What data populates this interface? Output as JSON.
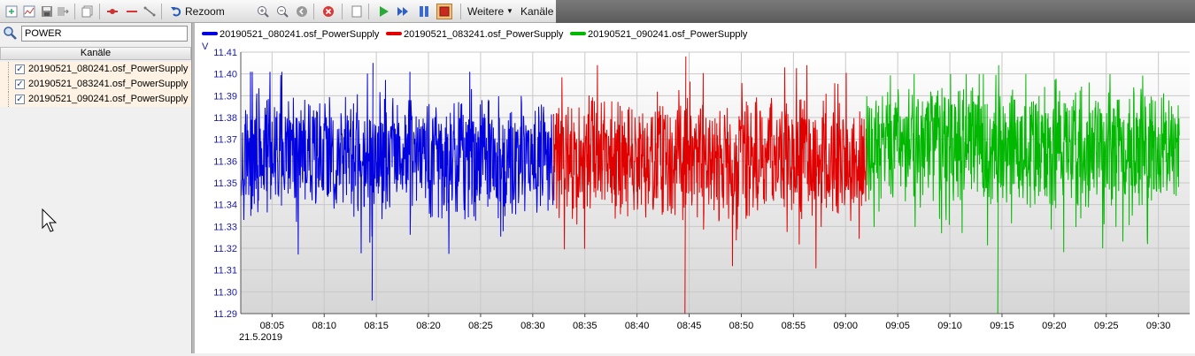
{
  "toolbar": {
    "rezoom_label": "Rezoom",
    "weitere_label": "Weitere",
    "kanale_label": "Kanäle",
    "icons": [
      "add-icon",
      "chart-icon",
      "save-icon",
      "export-icon",
      "copy-icon",
      "marker-icon",
      "line-icon",
      "connect-icon",
      "undo-icon",
      "zoom-in-icon",
      "zoom-out-icon",
      "back-icon",
      "stop-icon",
      "window-icon",
      "play-icon",
      "fast-forward-icon",
      "pause-icon",
      "record-icon"
    ]
  },
  "sidebar": {
    "search_value": "POWER",
    "header": "Kanäle",
    "channels": [
      {
        "label": "20190521_080241.osf_PowerSupply",
        "checked": true
      },
      {
        "label": "20190521_083241.osf_PowerSupply",
        "checked": true
      },
      {
        "label": "20190521_090241.osf_PowerSupply",
        "checked": true
      }
    ]
  },
  "chart_data": {
    "type": "line",
    "ylabel": "V",
    "ylim": [
      11.29,
      11.41
    ],
    "y_ticks": [
      "11.41",
      "11.40",
      "11.39",
      "11.38",
      "11.37",
      "11.36",
      "11.35",
      "11.34",
      "11.33",
      "11.32",
      "11.31",
      "11.30",
      "11.29"
    ],
    "x_ticks": [
      "08:05",
      "08:10",
      "08:15",
      "08:20",
      "08:25",
      "08:30",
      "08:35",
      "08:40",
      "08:45",
      "08:50",
      "08:55",
      "09:00",
      "09:05",
      "09:10",
      "09:15",
      "09:20",
      "09:25",
      "09:30"
    ],
    "date_label": "21.5.2019",
    "legend_position": "top-left",
    "grid": true,
    "series": [
      {
        "name": "20190521_080241.osf_PowerSupply",
        "color": "#0000e0",
        "x_range": [
          "08:02",
          "08:32"
        ],
        "mean": 11.362,
        "min": 11.296,
        "max": 11.405
      },
      {
        "name": "20190521_083241.osf_PowerSupply",
        "color": "#e00000",
        "x_range": [
          "08:32",
          "09:02"
        ],
        "mean": 11.362,
        "min": 11.29,
        "max": 11.408
      },
      {
        "name": "20190521_090241.osf_PowerSupply",
        "color": "#00b800",
        "x_range": [
          "09:02",
          "09:32"
        ],
        "mean": 11.367,
        "min": 11.29,
        "max": 11.404
      }
    ]
  }
}
